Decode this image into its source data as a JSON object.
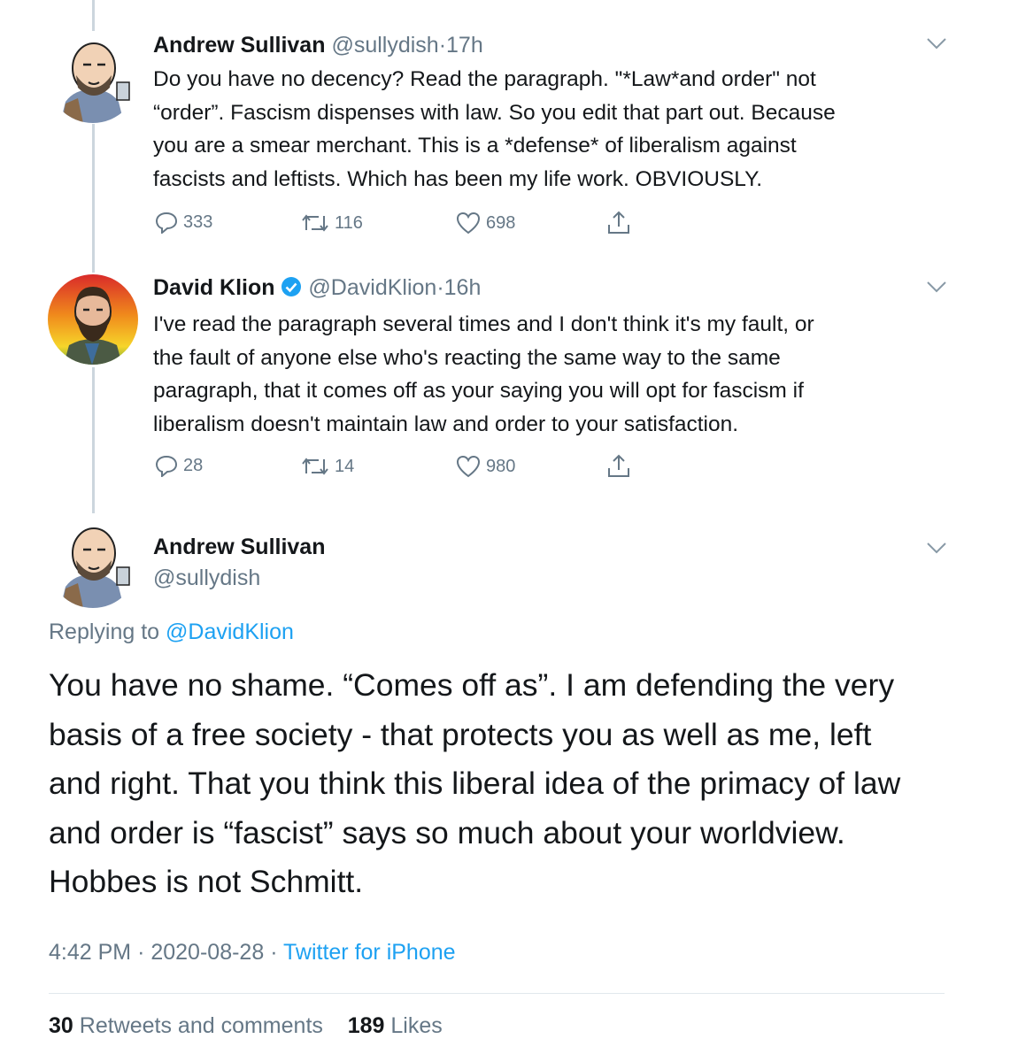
{
  "tweets": [
    {
      "name": "Andrew Sullivan",
      "handle": "@sullydish",
      "time": "17h",
      "text": "Do you have no decency? Read the paragraph. \"*Law*and order\" not\n“order”. Fascism dispenses with law. So you edit that part out. Because\nyou are a smear merchant. This is a *defense* of liberalism against\nfascists and leftists. Which has been my life work. OBVIOUSLY.",
      "replies": "333",
      "retweets": "116",
      "likes": "698"
    },
    {
      "name": "David Klion",
      "handle": "@DavidKlion",
      "time": "16h",
      "text": "I've read the paragraph several times and I don't think it's my fault, or\nthe fault of anyone else who's reacting the same way to the same\nparagraph, that it comes off as your saying you will opt for fascism if\nliberalism doesn't maintain law and order to your satisfaction.",
      "replies": "28",
      "retweets": "14",
      "likes": "980"
    }
  ],
  "main_tweet": {
    "name": "Andrew Sullivan",
    "handle": "@sullydish",
    "replying_prefix": "Replying to",
    "replying_to": "@DavidKlion",
    "text": "You have no shame. “Comes off as”. I am defending the very\nbasis of a free society - that protects you as well as me, left\nand right. That you think this liberal idea of the primacy of law\nand order is “fascist” says so much about your worldview.\nHobbes is not Schmitt.",
    "time": "4:42 PM",
    "date": "2020-08-28",
    "source": "Twitter for iPhone",
    "retweets_count": "30",
    "retweets_label": "Retweets and comments",
    "likes_count": "189",
    "likes_label": "Likes"
  },
  "colors": {
    "text": "#14171a",
    "secondary": "#657786",
    "link": "#1da1f2",
    "verified": "#1da1f2",
    "divider": "#e1e8ed",
    "thread": "#ccd6dd"
  }
}
